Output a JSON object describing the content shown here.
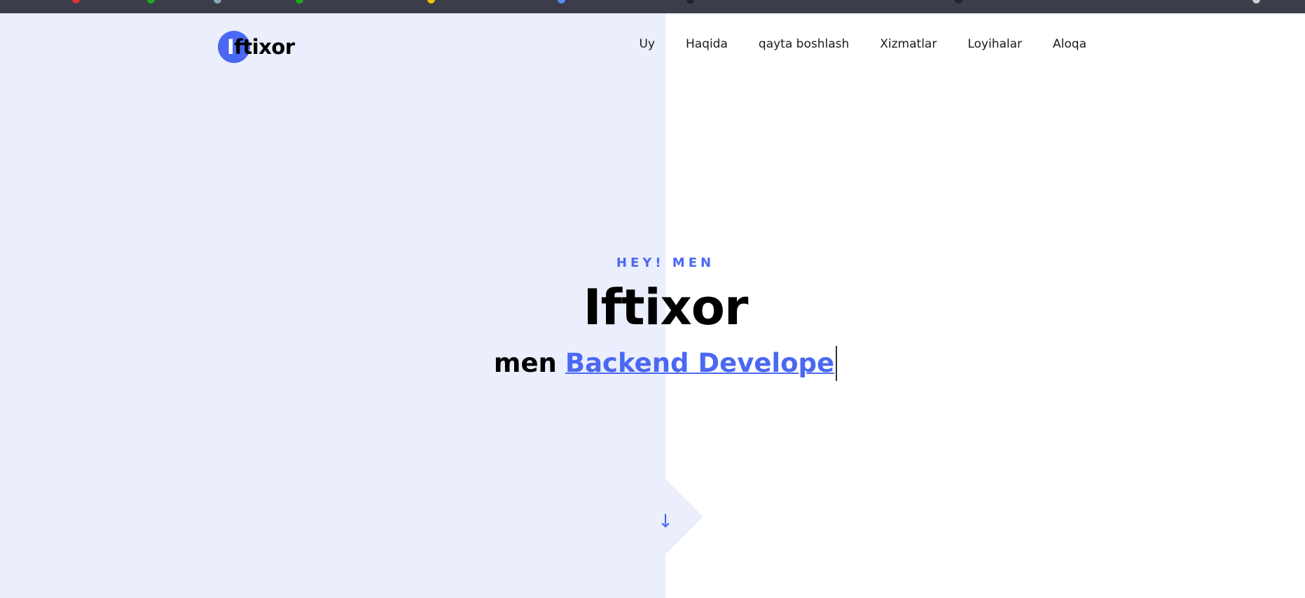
{
  "logo": {
    "first_letter": "I",
    "rest": "ftixor"
  },
  "nav": {
    "items": [
      "Uy",
      "Haqida",
      "qayta boshlash",
      "Xizmatlar",
      "Loyihalar",
      "Aloqa"
    ]
  },
  "hero": {
    "kicker": "HEY! MEN",
    "name": "Iftixor",
    "role_prefix": "men",
    "role_typed": "Backend Develope"
  },
  "scroll": {
    "icon": "arrow-down-icon",
    "glyph": "↓"
  },
  "colors": {
    "accent": "#4a68f3",
    "panel": "#ebeefc",
    "topbar": "#3b3d4b"
  }
}
